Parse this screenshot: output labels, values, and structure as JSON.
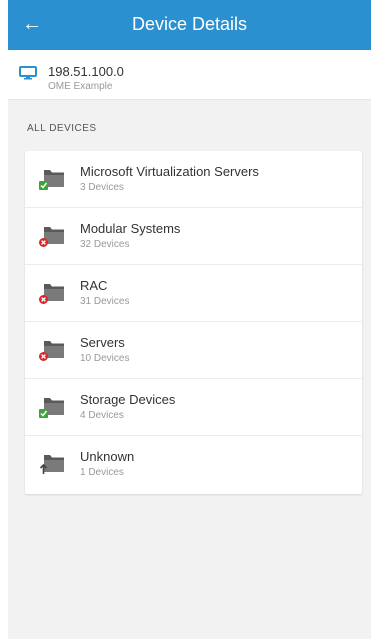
{
  "header": {
    "title": "Device Details",
    "back_icon": "arrow-left-icon"
  },
  "device": {
    "ip": "198.51.100.0",
    "name": "OME Example",
    "icon": "monitor-icon"
  },
  "section_label": "ALL DEVICES",
  "groups": [
    {
      "name": "Microsoft Virtualization Servers",
      "count": "3 Devices",
      "status": "ok"
    },
    {
      "name": "Modular Systems",
      "count": "32 Devices",
      "status": "critical"
    },
    {
      "name": "RAC",
      "count": "31 Devices",
      "status": "critical"
    },
    {
      "name": "Servers",
      "count": "10 Devices",
      "status": "critical"
    },
    {
      "name": "Storage Devices",
      "count": "4 Devices",
      "status": "ok"
    },
    {
      "name": "Unknown",
      "count": "1 Devices",
      "status": "unknown"
    }
  ],
  "colors": {
    "header_bg": "#2b90cf",
    "ok": "#3aa63a",
    "critical": "#d9262b",
    "unknown": "#444444",
    "folder": "#5a5a5a"
  }
}
